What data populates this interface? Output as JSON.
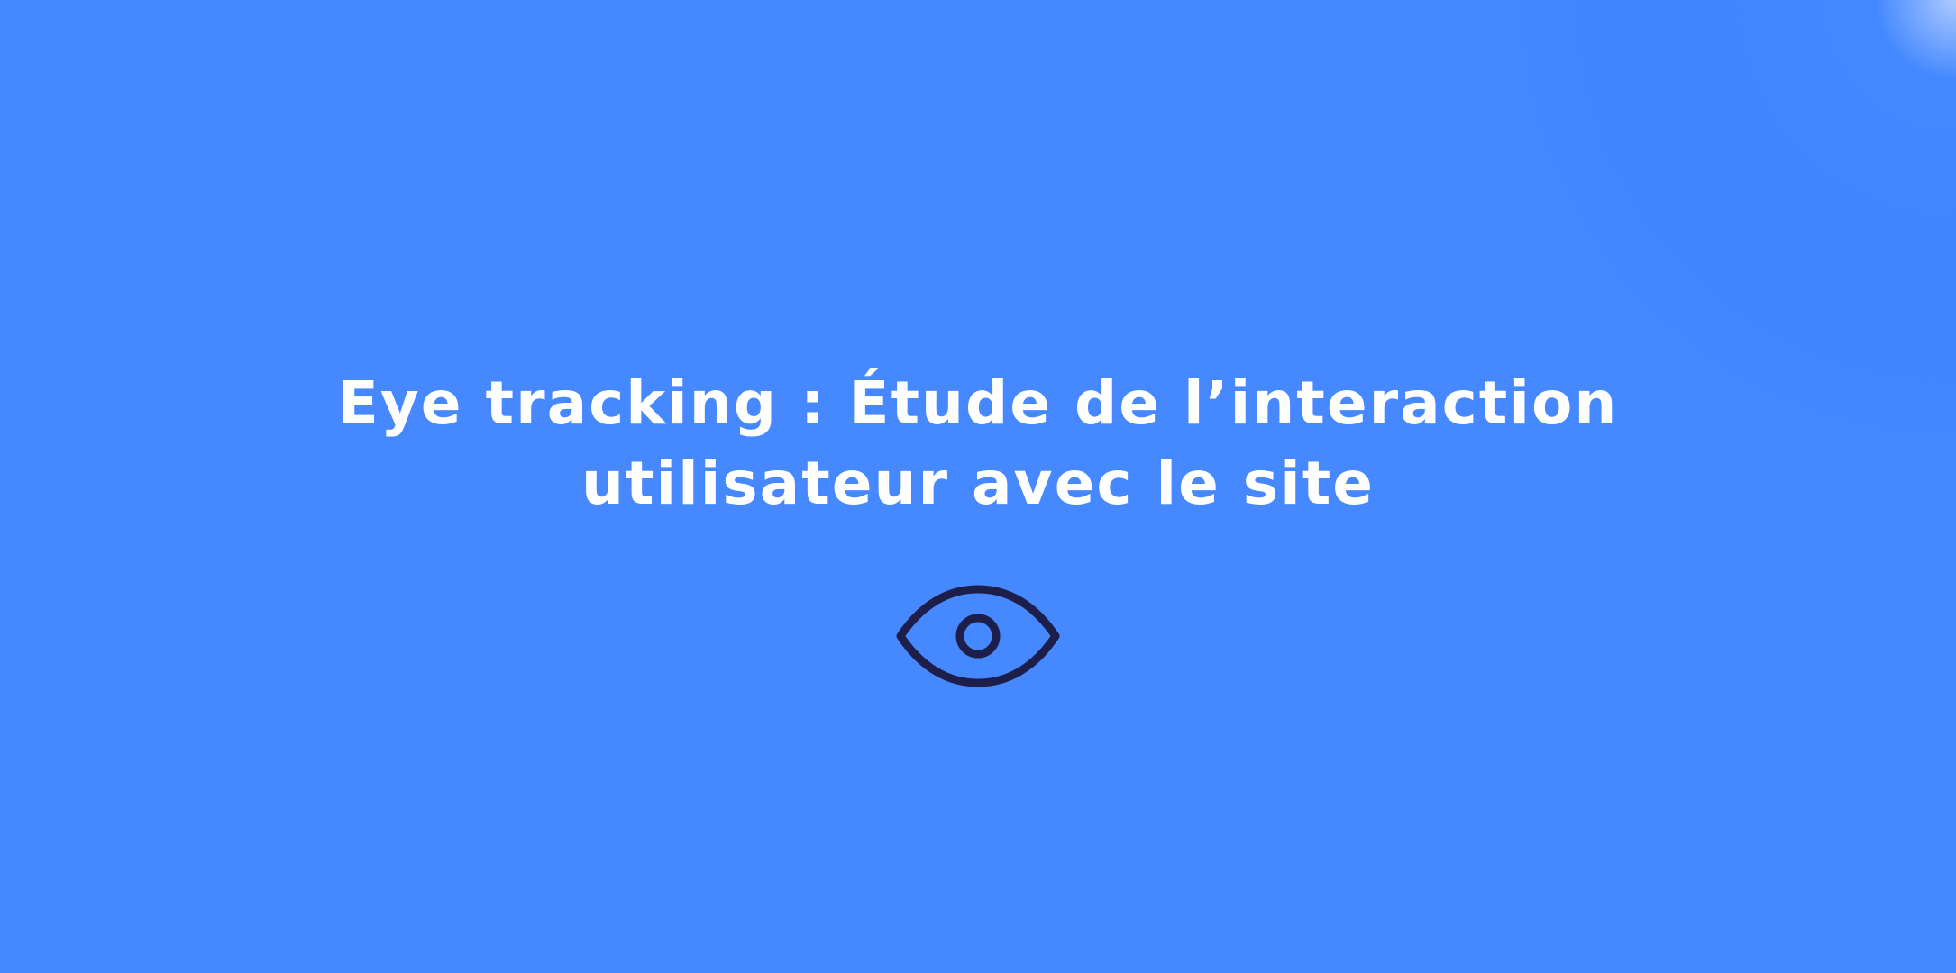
{
  "banner": {
    "title_line_1": "Eye tracking : Étude de l’interaction",
    "title_line_2": "utilisateur avec le site",
    "icon": "eye-icon"
  },
  "colors": {
    "background": "#4688ff",
    "title_text": "#ffffff",
    "icon_stroke": "#1d1f4a",
    "corner_highlight": "#2b7bff"
  }
}
